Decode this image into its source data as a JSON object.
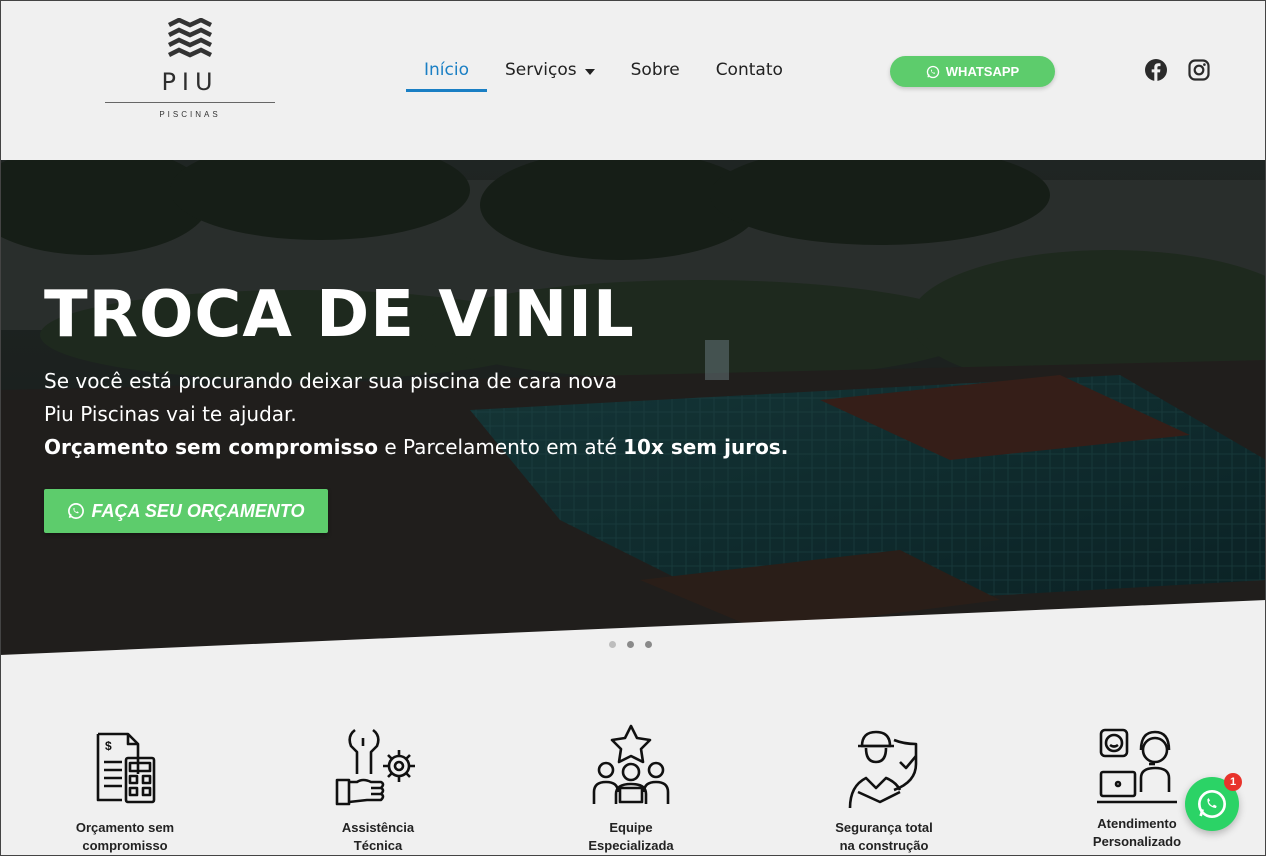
{
  "logo": {
    "brand": "PIU",
    "subtitle": "PISCINAS"
  },
  "nav": {
    "items": [
      {
        "label": "Início",
        "active": true
      },
      {
        "label": "Serviços",
        "has_dropdown": true
      },
      {
        "label": "Sobre"
      },
      {
        "label": "Contato"
      }
    ]
  },
  "header": {
    "whatsapp_label": "WHATSAPP",
    "social": [
      "facebook-icon",
      "instagram-icon"
    ]
  },
  "hero": {
    "title": "TROCA DE VINIL",
    "line1": "Se você está procurando deixar sua piscina de cara nova",
    "line2": "Piu Piscinas vai te ajudar.",
    "line3_bold1": "Orçamento sem compromisso",
    "line3_mid": " e Parcelamento em até ",
    "line3_bold2": "10x sem juros.",
    "cta_label": "FAÇA SEU ORÇAMENTO",
    "slides": 3,
    "active_slide": 1
  },
  "features": [
    {
      "icon": "budget-calculator-icon",
      "line1": "Orçamento sem",
      "line2": "compromisso"
    },
    {
      "icon": "wrench-gear-icon",
      "line1": "Assistência",
      "line2": "Técnica"
    },
    {
      "icon": "team-star-icon",
      "line1": "Equipe",
      "line2": "Especializada"
    },
    {
      "icon": "worker-shield-icon",
      "line1": "Segurança total",
      "line2": "na construção"
    },
    {
      "icon": "support-agent-icon",
      "line1": "Atendimento",
      "line2": "Personalizado"
    }
  ],
  "floating_chat": {
    "badge": "1"
  },
  "colors": {
    "accent": "#1a7fc4",
    "green": "#5dcc6c",
    "whatsapp": "#2bd366",
    "badge": "#e8332b"
  }
}
